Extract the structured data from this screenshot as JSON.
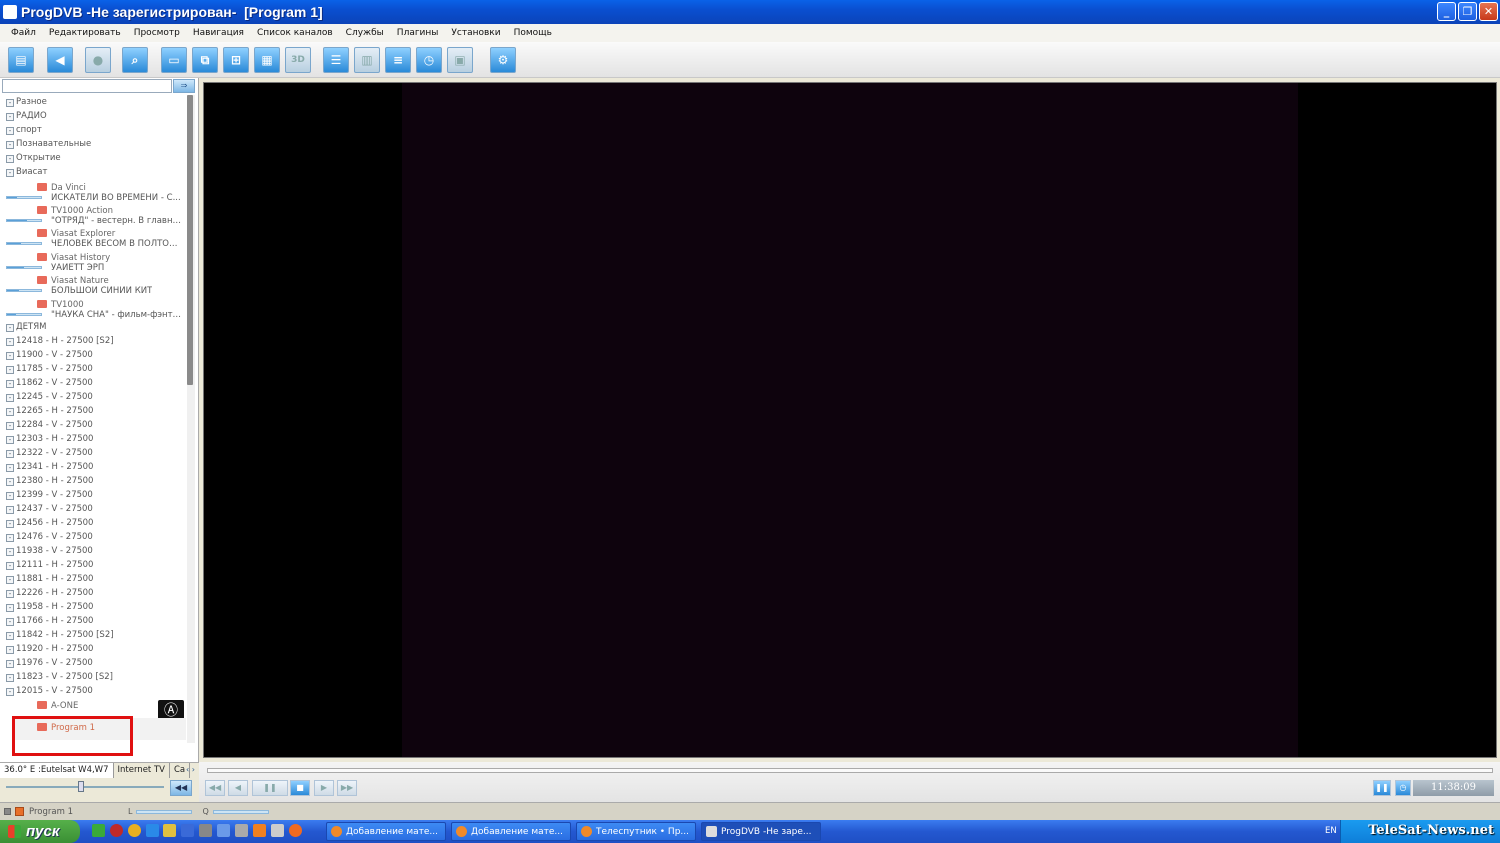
{
  "window": {
    "title": "ProgDVB -Не зарегистрирован-  [Program 1]"
  },
  "window_buttons": {
    "minimize": "_",
    "maximize": "❐",
    "close": "✕"
  },
  "menu": [
    "Файл",
    "Редактировать",
    "Просмотр",
    "Навигация",
    "Список каналов",
    "Службы",
    "Плагины",
    "Установки",
    "Помощь"
  ],
  "toolbar": {
    "threed_label": "3D"
  },
  "groups_top": [
    "Разное",
    "РАДИО",
    "спорт",
    "Познавательные",
    "Открытие",
    "Виасат"
  ],
  "channels": [
    {
      "name": "Da Vinci",
      "program": "ИСКАТЕЛИ ВО ВРЕМЕНИ  - С...",
      "progress": 0.3
    },
    {
      "name": "TV1000 Action",
      "program": "\"ОТРЯД\" - вестерн. В главной...",
      "progress": 0.6
    },
    {
      "name": "Viasat Explorer",
      "program": "ЧЕЛОВЕК ВЕСОМ В ПОЛТОН...",
      "progress": 0.4
    },
    {
      "name": "Viasat History",
      "program": "УАЙЕТТ ЭРП",
      "progress": 0.5
    },
    {
      "name": "Viasat Nature",
      "program": "БОЛЬШОЙ СИНИЙ КИТ",
      "progress": 0.35
    },
    {
      "name": "TV1000",
      "program": "\"НАУКА СНА\" - фильм-фэнте...",
      "progress": 0.25
    }
  ],
  "group_kids": "ДЕТЯМ",
  "transponders": [
    "12418 - H - 27500 [S2]",
    "11900 - V - 27500",
    "11785 - V - 27500",
    "11862 - V - 27500",
    "12245 - V - 27500",
    "12265 - H - 27500",
    "12284 - V - 27500",
    "12303 - H - 27500",
    "12322 - V - 27500",
    "12341 - H - 27500",
    "12380 - H - 27500",
    "12399 - V - 27500",
    "12437 - V - 27500",
    "12456 - H - 27500",
    "12476 - V - 27500",
    "11938 - V - 27500",
    "12111 - H - 27500",
    "11881 - H - 27500",
    "12226 - H - 27500",
    "11958 - H - 27500",
    "11766 - H - 27500",
    "11842 - H - 27500 [S2]",
    "11920 - H - 27500",
    "11976 - V - 27500",
    "11823 - V - 27500 [S2]",
    "12015 - V - 27500"
  ],
  "last_channels": [
    {
      "name": "A-ONE"
    },
    {
      "name": "Program 1"
    }
  ],
  "logo_symbol": "Ⓐ",
  "tabs": [
    "36.0° E :Eutelsat W4,W7",
    "Internet TV",
    "Ca"
  ],
  "tab_arrows": "‹ ›",
  "player": {
    "time": "11:38:09"
  },
  "status": {
    "channel": "Program 1",
    "level_label": "L",
    "quality_label": "Q"
  },
  "taskbar": {
    "start": "пуск",
    "tasks": [
      "Добавление мате...",
      "Добавление мате...",
      "Телеспутник • Пр...",
      "ProgDVB -Не заре..."
    ],
    "lang": "EN",
    "watermark": "TeleSat-News.net"
  }
}
